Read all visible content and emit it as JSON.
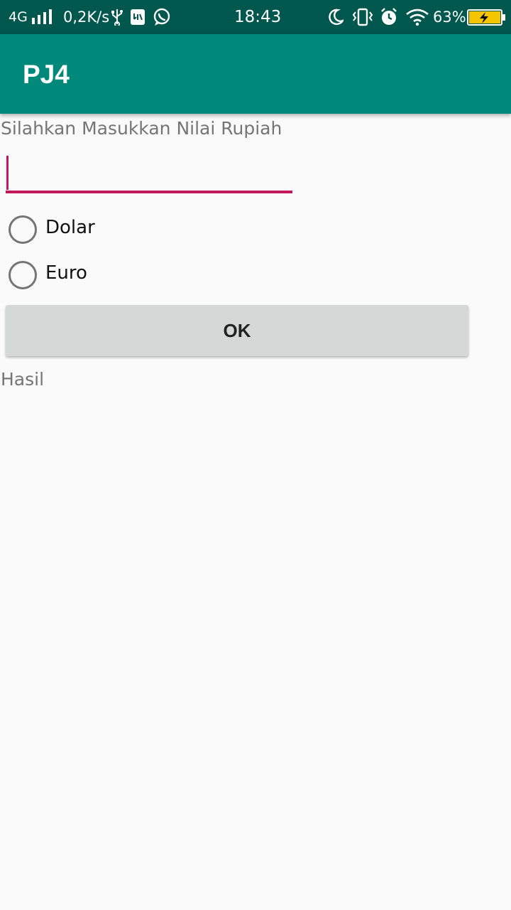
{
  "status_bar": {
    "network": "4G",
    "speed": "0,2K/s",
    "time": "18:43",
    "battery": "63%",
    "icons": [
      "signal-icon",
      "usb-icon",
      "sd-card-icon",
      "whatsapp-icon",
      "moon-icon",
      "vibrate-icon",
      "alarm-icon",
      "wifi-icon",
      "battery-icon"
    ],
    "background": "#00574d"
  },
  "app_bar": {
    "title": "PJ4",
    "background": "#00897b"
  },
  "form": {
    "prompt_label": "Silahkan Masukkan Nilai Rupiah",
    "input_value": "",
    "input_accent": "#c2185b",
    "options": [
      {
        "label": "Dolar",
        "selected": false
      },
      {
        "label": "Euro",
        "selected": false
      }
    ],
    "ok_button": "OK",
    "result_label": "Hasil"
  }
}
